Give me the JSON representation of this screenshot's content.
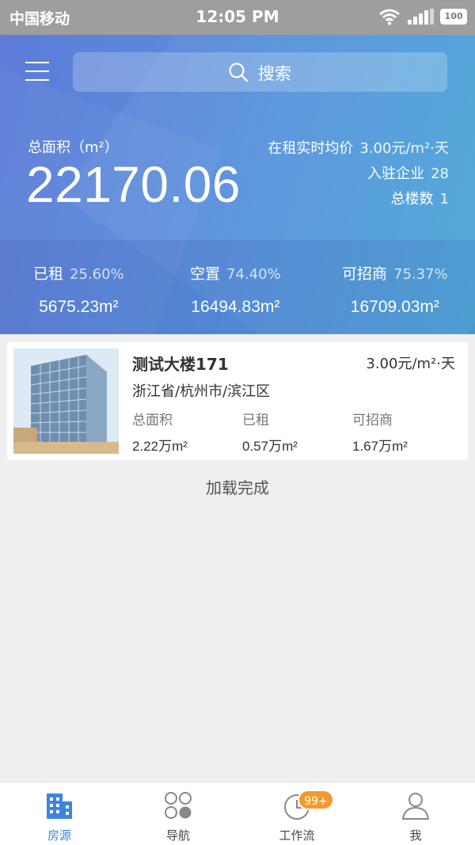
{
  "status_bar": {
    "carrier": "中国移动",
    "time": "12:05 PM",
    "battery": "100"
  },
  "search": {
    "placeholder": "搜索"
  },
  "summary": {
    "total_area_label": "总面积（m²）",
    "total_area_value": "22170.06",
    "avg_price_label": "在租实时均价",
    "avg_price_value": "3.00元/m²·天",
    "companies_label": "入驻企业",
    "companies_value": "28",
    "buildings_label": "总楼数",
    "buildings_value": "1"
  },
  "stats": [
    {
      "label": "已租",
      "percent": "25.60%",
      "amount": "5675.23m²"
    },
    {
      "label": "空置",
      "percent": "74.40%",
      "amount": "16494.83m²"
    },
    {
      "label": "可招商",
      "percent": "75.37%",
      "amount": "16709.03m²"
    }
  ],
  "building": {
    "name": "测试大楼171",
    "price": "3.00元/m²·天",
    "address": "浙江省/杭州市/滨江区",
    "total_label": "总面积",
    "total_value": "2.22万m²",
    "rented_label": "已租",
    "rented_value": "0.57万m²",
    "available_label": "可招商",
    "available_value": "1.67万m²"
  },
  "list_footer": "加载完成",
  "tabs": [
    {
      "label": "房源",
      "icon": "building-icon",
      "active": true
    },
    {
      "label": "导航",
      "icon": "grid-circles-icon",
      "active": false
    },
    {
      "label": "工作流",
      "icon": "clock-icon",
      "active": false,
      "badge": "99+"
    },
    {
      "label": "我",
      "icon": "person-icon",
      "active": false
    }
  ],
  "colors": {
    "header_start": "#5e7bd8",
    "header_end": "#4aa7d8",
    "active_tab": "#3b86e0",
    "badge": "#f39a2c"
  }
}
